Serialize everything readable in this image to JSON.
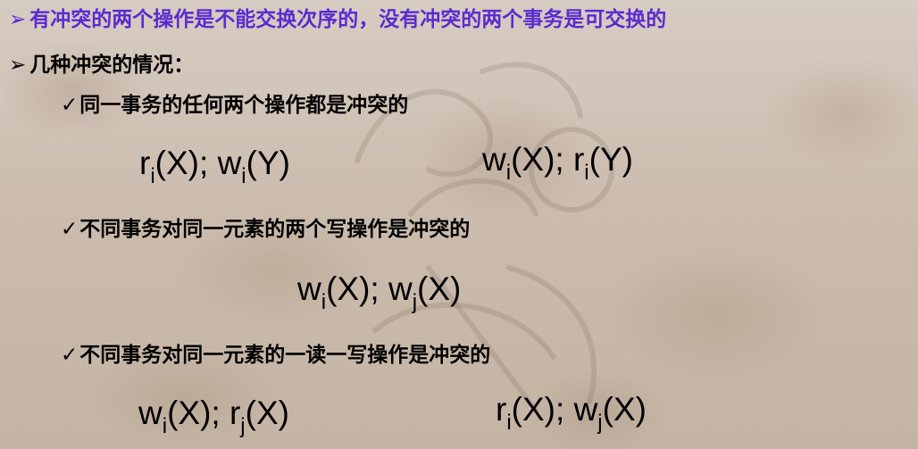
{
  "bullets": {
    "arrow_glyph": "➢",
    "check_glyph": "✓",
    "header1": "有冲突的两个操作是不能交换次序的，没有冲突的两个事务是可交换的",
    "header2": "几种冲突的情况：",
    "sub1": "同一事务的任何两个操作都是冲突的",
    "sub2": "不同事务对同一元素的两个写操作是冲突的",
    "sub3": "不同事务对同一元素的一读一写操作是冲突的"
  },
  "formulas": {
    "f1": {
      "op1": "r",
      "s1": "i",
      "a1": "(X); ",
      "op2": "w",
      "s2": "i",
      "a2": "(Y)"
    },
    "f2": {
      "op1": "w",
      "s1": "i",
      "a1": "(X); ",
      "op2": "r",
      "s2": "i",
      "a2": "(Y)"
    },
    "f3": {
      "op1": "w",
      "s1": "i",
      "a1": "(X); ",
      "op2": "w",
      "s2": "j",
      "a2": "(X)"
    },
    "f4": {
      "op1": "w",
      "s1": "i",
      "a1": "(X); ",
      "op2": "r",
      "s2": "j",
      "a2": "(X)"
    },
    "f5": {
      "op1": "r",
      "s1": "i",
      "a1": "(X); ",
      "op2": "w",
      "s2": "j",
      "a2": "(X)"
    }
  },
  "colors": {
    "header_accent": "#5b2bd0",
    "text": "#000000"
  }
}
